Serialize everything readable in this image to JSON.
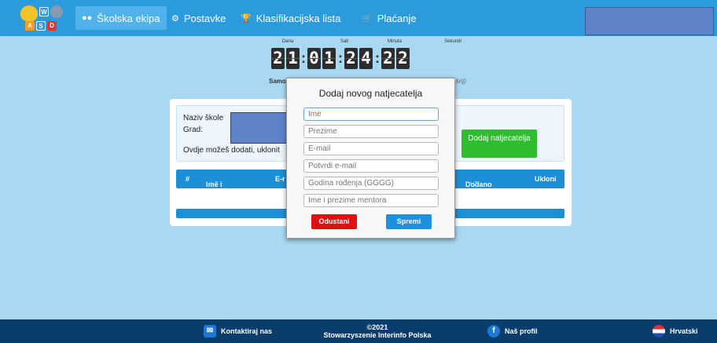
{
  "nav": {
    "logo_letters": [
      "W",
      "A",
      "S",
      "D"
    ],
    "items": [
      {
        "icon": "users-icon",
        "label": "Školska ekipa",
        "active": true
      },
      {
        "icon": "gear-icon",
        "label": "Postavke",
        "active": false
      },
      {
        "icon": "trophy-icon",
        "label": "Klasifikacijska lista",
        "active": false
      },
      {
        "icon": "cart-icon",
        "label": "Plaćanje",
        "active": false
      }
    ]
  },
  "countdown": {
    "labels": {
      "days": "Dana",
      "hours": "Sati",
      "minutes": "Minuta",
      "seconds": "Sekundi"
    },
    "digits": [
      "2",
      "1",
      "0",
      "1",
      "2",
      "4",
      "2",
      "2"
    ],
    "sub_left": "Samo",
    "sub_right": "krij)"
  },
  "card": {
    "school_label": "Naziv škole",
    "city_label": "Grad:",
    "note": "Ovdje možeš dodati, uklonit",
    "add_button": "Dodaj natjecatelja",
    "table_headers": {
      "num": "#",
      "name": "Ime i prezime",
      "email": "E-r",
      "added": "Dodano dana",
      "remove": "Ukloni"
    }
  },
  "modal": {
    "title": "Dodaj novog natjecatelja",
    "fields": {
      "first_name": "Ime",
      "last_name": "Prezime",
      "email": "E-mail",
      "email_confirm": "Potvrdi e-mail",
      "birth_year": "Godina rođenja (GGGG)",
      "mentor": "Ime i prezime mentora"
    },
    "cancel": "Odustani",
    "save": "Spremi"
  },
  "footer": {
    "contact": "Kontaktiraj nas",
    "copyright": "©2021",
    "org": "Stowarzyszenie Interinfo Polska",
    "profile": "Naš profil",
    "language": "Hrvatski"
  },
  "colors": {
    "nav": "#2c9bdc",
    "background": "#a9d9f2",
    "footer": "#0a3d6b",
    "add_button": "#2ebd2e",
    "cancel": "#e01010",
    "save": "#1e90e0"
  }
}
